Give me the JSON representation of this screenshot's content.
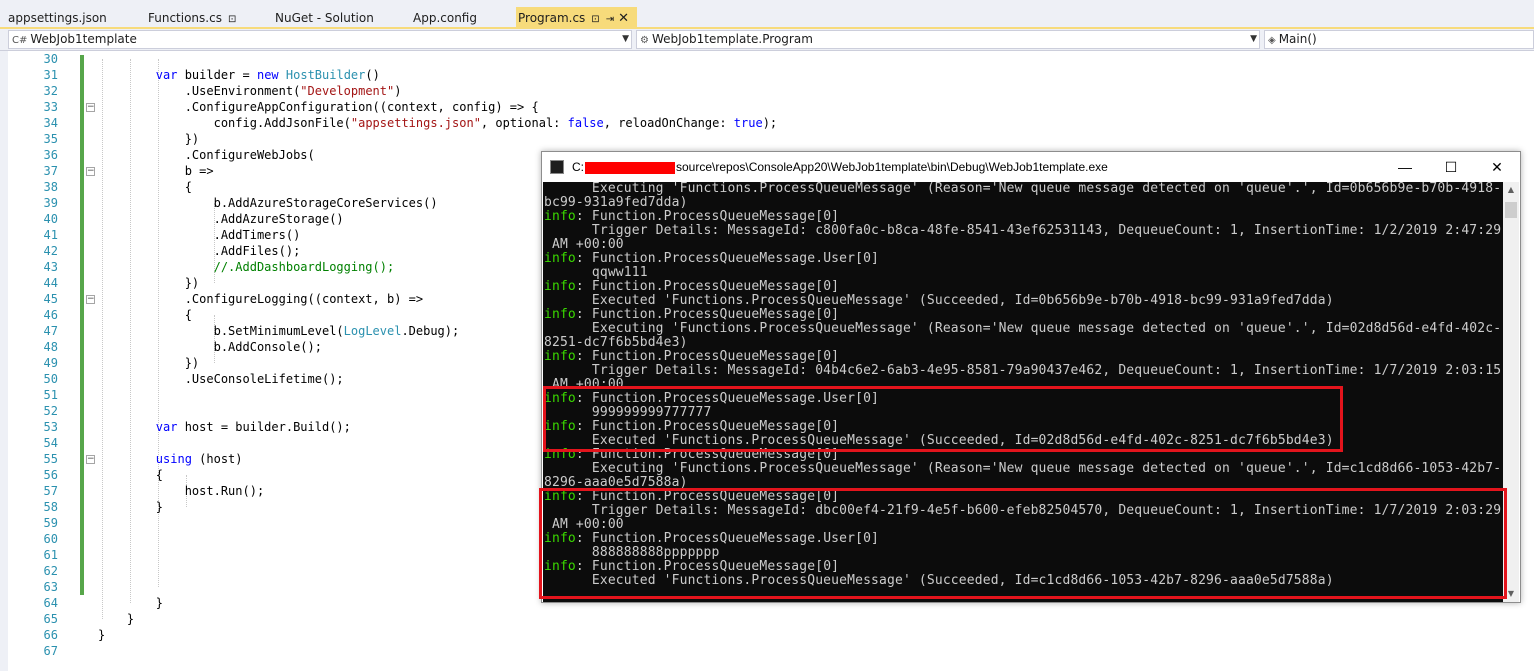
{
  "tabs": [
    {
      "label": "appsettings.json",
      "active": false,
      "pinned": false
    },
    {
      "label": "Functions.cs",
      "active": false,
      "pinned": true
    },
    {
      "label": "NuGet - Solution",
      "active": false,
      "pinned": false
    },
    {
      "label": "App.config",
      "active": false,
      "pinned": false
    },
    {
      "label": "Program.cs",
      "active": true,
      "pinned": true
    }
  ],
  "tab_icons": {
    "pin": "⊡",
    "pin_active": "⇥",
    "close": "✕"
  },
  "navbar": {
    "project": "WebJob1template",
    "type": "WebJob1template.Program",
    "member": "Main()"
  },
  "editor": {
    "line_numbers": [
      "30",
      "31",
      "32",
      "33",
      "34",
      "35",
      "36",
      "37",
      "38",
      "39",
      "40",
      "41",
      "42",
      "43",
      "44",
      "45",
      "46",
      "47",
      "48",
      "49",
      "50",
      "51",
      "52",
      "53",
      "54",
      "55",
      "56",
      "57",
      "58",
      "59",
      "60",
      "61",
      "62",
      "63",
      "64",
      "65",
      "66",
      "67"
    ]
  },
  "console": {
    "title_prefix": "C:",
    "title_suffix": "source\\repos\\ConsoleApp20\\WebJob1template\\bin\\Debug\\WebJob1template.exe",
    "minimize": "—",
    "maximize": "☐",
    "close": "✕",
    "lines": [
      {
        "tag": "",
        "text": "      Executing 'Functions.ProcessQueueMessage' (Reason='New queue message detected on 'queue'.', Id=0b656b9e-b70b-4918-"
      },
      {
        "tag": "",
        "text": "bc99-931a9fed7dda)"
      },
      {
        "tag": "info",
        "text": ": Function.ProcessQueueMessage[0]"
      },
      {
        "tag": "",
        "text": "      Trigger Details: MessageId: c800fa0c-b8ca-48fe-8541-43ef62531143, DequeueCount: 1, InsertionTime: 1/2/2019 2:47:29"
      },
      {
        "tag": "",
        "text": " AM +00:00"
      },
      {
        "tag": "info",
        "text": ": Function.ProcessQueueMessage.User[0]"
      },
      {
        "tag": "",
        "text": "      qqww111"
      },
      {
        "tag": "info",
        "text": ": Function.ProcessQueueMessage[0]"
      },
      {
        "tag": "",
        "text": "      Executed 'Functions.ProcessQueueMessage' (Succeeded, Id=0b656b9e-b70b-4918-bc99-931a9fed7dda)"
      },
      {
        "tag": "info",
        "text": ": Function.ProcessQueueMessage[0]"
      },
      {
        "tag": "",
        "text": "      Executing 'Functions.ProcessQueueMessage' (Reason='New queue message detected on 'queue'.', Id=02d8d56d-e4fd-402c-"
      },
      {
        "tag": "",
        "text": "8251-dc7f6b5bd4e3)"
      },
      {
        "tag": "info",
        "text": ": Function.ProcessQueueMessage[0]"
      },
      {
        "tag": "",
        "text": "      Trigger Details: MessageId: 04b4c6e2-6ab3-4e95-8581-79a90437e462, DequeueCount: 1, InsertionTime: 1/7/2019 2:03:15"
      },
      {
        "tag": "",
        "text": " AM +00:00"
      },
      {
        "tag": "info",
        "text": ": Function.ProcessQueueMessage.User[0]"
      },
      {
        "tag": "",
        "text": "      999999999777777"
      },
      {
        "tag": "info",
        "text": ": Function.ProcessQueueMessage[0]"
      },
      {
        "tag": "",
        "text": "      Executed 'Functions.ProcessQueueMessage' (Succeeded, Id=02d8d56d-e4fd-402c-8251-dc7f6b5bd4e3)"
      },
      {
        "tag": "info",
        "text": ": Function.ProcessQueueMessage[0]"
      },
      {
        "tag": "",
        "text": "      Executing 'Functions.ProcessQueueMessage' (Reason='New queue message detected on 'queue'.', Id=c1cd8d66-1053-42b7-"
      },
      {
        "tag": "",
        "text": "8296-aaa0e5d7588a)"
      },
      {
        "tag": "info",
        "text": ": Function.ProcessQueueMessage[0]"
      },
      {
        "tag": "",
        "text": "      Trigger Details: MessageId: dbc00ef4-21f9-4e5f-b600-efeb82504570, DequeueCount: 1, InsertionTime: 1/7/2019 2:03:29"
      },
      {
        "tag": "",
        "text": " AM +00:00"
      },
      {
        "tag": "info",
        "text": ": Function.ProcessQueueMessage.User[0]"
      },
      {
        "tag": "",
        "text": "      888888888ppppppp"
      },
      {
        "tag": "info",
        "text": ": Function.ProcessQueueMessage[0]"
      },
      {
        "tag": "",
        "text": "      Executed 'Functions.ProcessQueueMessage' (Succeeded, Id=c1cd8d66-1053-42b7-8296-aaa0e5d7588a)"
      }
    ]
  },
  "colors": {
    "highlight": "#e3141c",
    "info": "#3ad900",
    "tab_active": "#f7db7b"
  }
}
